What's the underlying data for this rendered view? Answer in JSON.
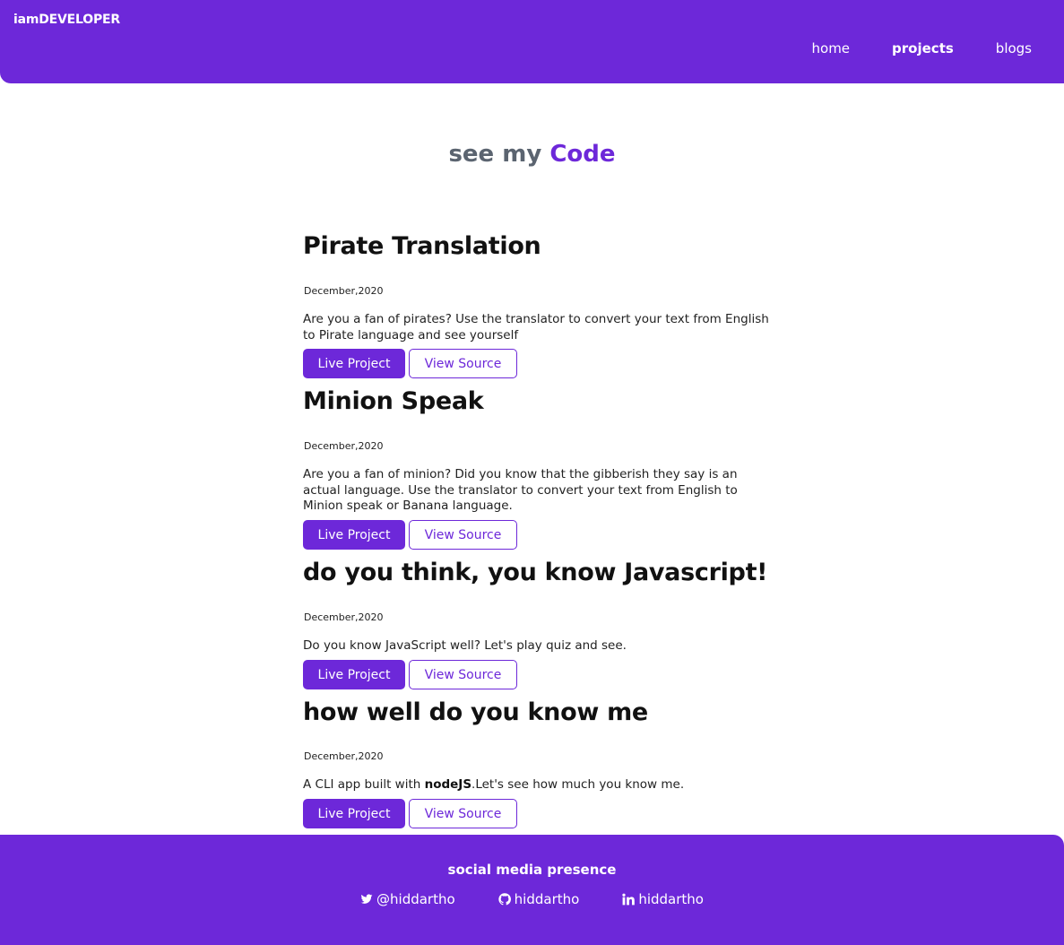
{
  "brand": "iamDEVELOPER",
  "nav": {
    "items": [
      {
        "label": "home",
        "active": false
      },
      {
        "label": "projects",
        "active": true
      },
      {
        "label": "blogs",
        "active": false
      }
    ]
  },
  "hero": {
    "prefix": "see my",
    "highlight": "Code"
  },
  "projects": [
    {
      "title": "Pirate Translation",
      "date": "December,2020",
      "description": "Are you a fan of pirates? Use the translator to convert your text from English to Pirate language and see yourself",
      "live_label": "Live Project",
      "source_label": "View Source"
    },
    {
      "title": "Minion Speak",
      "date": "December,2020",
      "description": "Are you a fan of minion? Did you know that the gibberish they say is an actual language. Use the translator to convert your text from English to Minion speak or Banana language.",
      "live_label": "Live Project",
      "source_label": "View Source"
    },
    {
      "title": "do you think, you know Javascript!",
      "date": "December,2020",
      "description": "Do you know JavaScript well? Let's play quiz and see.",
      "live_label": "Live Project",
      "source_label": "View Source"
    },
    {
      "title": "how well do you know me",
      "date": "December,2020",
      "description_prefix": "A CLI app built with ",
      "description_bold": "nodeJS",
      "description_suffix": ".Let's see how much you know me.",
      "live_label": "Live Project",
      "source_label": "View Source"
    }
  ],
  "footer": {
    "title": "social media presence",
    "links": [
      {
        "icon": "twitter-icon",
        "label": "@hiddartho"
      },
      {
        "icon": "github-icon",
        "label": "hiddartho"
      },
      {
        "icon": "linkedin-icon",
        "label": "hiddartho"
      }
    ]
  },
  "colors": {
    "primary": "#6d28d9",
    "muted": "#5b6470"
  }
}
